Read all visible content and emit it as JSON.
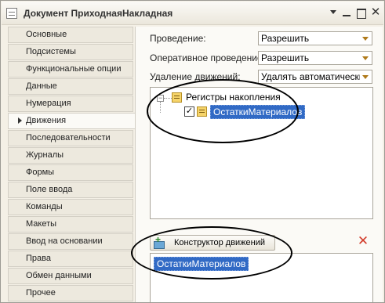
{
  "window": {
    "title": "Документ ПриходнаяНакладная"
  },
  "sidebar": {
    "items": [
      {
        "label": "Основные"
      },
      {
        "label": "Подсистемы"
      },
      {
        "label": "Функциональные опции"
      },
      {
        "label": "Данные"
      },
      {
        "label": "Нумерация"
      },
      {
        "label": "Движения",
        "active": true
      },
      {
        "label": "Последовательности"
      },
      {
        "label": "Журналы"
      },
      {
        "label": "Формы"
      },
      {
        "label": "Поле ввода"
      },
      {
        "label": "Команды"
      },
      {
        "label": "Макеты"
      },
      {
        "label": "Ввод на основании"
      },
      {
        "label": "Права"
      },
      {
        "label": "Обмен данными"
      },
      {
        "label": "Прочее"
      }
    ]
  },
  "main": {
    "fields": [
      {
        "label": "Проведение:",
        "value": "Разрешить"
      },
      {
        "label": "Оперативное проведение:",
        "value": "Разрешить"
      },
      {
        "label": "Удаление движений:",
        "value": "Удалять автоматически"
      }
    ],
    "tree": {
      "group_label": "Регистры накопления",
      "item_label": "ОстаткиМатериалов",
      "item_checked": true,
      "check_mark": "✓"
    },
    "constructor_button": "Конструктор движений",
    "text_value": "ОстаткиМатериалов"
  },
  "icons": {
    "delete": "✕"
  },
  "colors": {
    "selection": "#316ac5",
    "delete_icon": "#d23b2a"
  }
}
